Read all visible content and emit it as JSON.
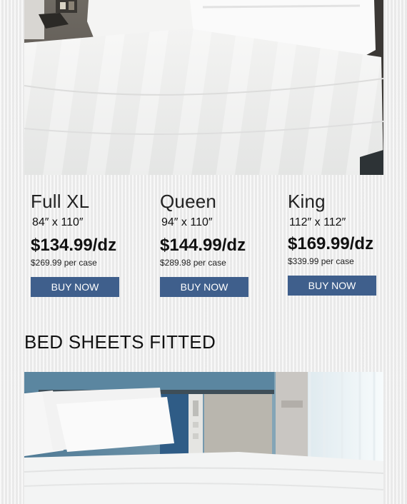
{
  "products": [
    {
      "name": "Full XL",
      "size": "84″ x 110″",
      "price": "$134.99/dz",
      "case_price": "$269.99 per case",
      "button_label": "BUY NOW"
    },
    {
      "name": "Queen",
      "size": "94″ x 110″",
      "price": "$144.99/dz",
      "case_price": "$289.98 per case",
      "button_label": "BUY NOW"
    },
    {
      "name": "King",
      "size": "112″ x 112″",
      "price": "$169.99/dz",
      "case_price": "$339.99 per case",
      "button_label": "BUY NOW"
    }
  ],
  "section": {
    "title": "BED SHEETS FITTED"
  },
  "colors": {
    "button": "#3f5f8c",
    "background": "#efefef"
  }
}
